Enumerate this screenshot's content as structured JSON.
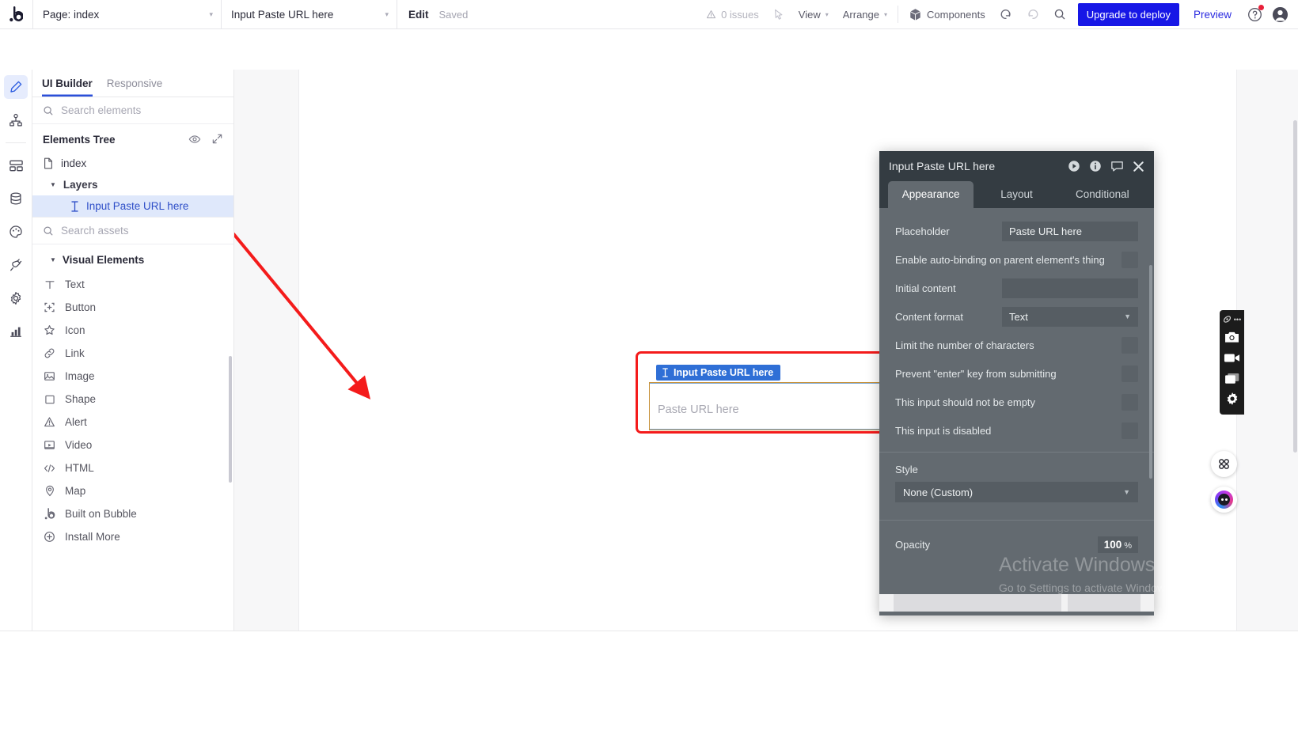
{
  "topbar": {
    "logo": "b",
    "page_select": {
      "label": "Page: index",
      "caret": "▾"
    },
    "element_select": {
      "label": "Input Paste URL here",
      "caret": "▾"
    },
    "edit_label": "Edit",
    "saved_label": "Saved",
    "issues": "0 issues",
    "view": "View",
    "arrange": "Arrange",
    "components": "Components",
    "upgrade": "Upgrade to deploy",
    "preview": "Preview",
    "accent_blue": "#1717e6",
    "notification_dot": "#e8203a"
  },
  "rail": {
    "items": [
      {
        "name": "design-pencil",
        "icon": "pencil-icon",
        "active": true
      },
      {
        "name": "workflow",
        "icon": "workflow-icon",
        "active": false
      },
      {
        "name": "layout",
        "icon": "layout-icon",
        "active": false
      },
      {
        "name": "data",
        "icon": "database-icon",
        "active": false
      },
      {
        "name": "styles",
        "icon": "palette-icon",
        "active": false
      },
      {
        "name": "plugins",
        "icon": "plug-icon",
        "active": false
      },
      {
        "name": "settings",
        "icon": "gear-icon",
        "active": false
      },
      {
        "name": "logs",
        "icon": "bar-chart-icon",
        "active": false
      }
    ]
  },
  "left_panel": {
    "tabs": [
      {
        "label": "UI Builder",
        "active": true
      },
      {
        "label": "Responsive",
        "active": false
      }
    ],
    "search_elements_placeholder": "Search elements",
    "elements_tree_title": "Elements Tree",
    "tree": [
      {
        "label": "index",
        "icon": "page-icon",
        "level": 0,
        "selected": false
      },
      {
        "label": "Layers",
        "icon": "triangle-down-icon",
        "level": 1,
        "selected": false
      },
      {
        "label": "Input Paste URL here",
        "icon": "input-cursor-icon",
        "level": 2,
        "selected": true
      }
    ],
    "search_assets_placeholder": "Search assets",
    "visual_elements_title": "Visual Elements",
    "visual_elements": [
      {
        "label": "Text",
        "icon": "text-icon"
      },
      {
        "label": "Button",
        "icon": "button-icon"
      },
      {
        "label": "Icon",
        "icon": "star-icon"
      },
      {
        "label": "Link",
        "icon": "link-icon"
      },
      {
        "label": "Image",
        "icon": "image-icon"
      },
      {
        "label": "Shape",
        "icon": "square-icon"
      },
      {
        "label": "Alert",
        "icon": "alert-triangle-icon"
      },
      {
        "label": "Video",
        "icon": "video-icon"
      },
      {
        "label": "HTML",
        "icon": "code-icon"
      },
      {
        "label": "Map",
        "icon": "map-pin-icon"
      },
      {
        "label": "Built on Bubble",
        "icon": "bubble-logo-icon"
      },
      {
        "label": "Install More",
        "icon": "plus-circle-icon"
      }
    ]
  },
  "canvas": {
    "element_badge": "Input Paste URL here",
    "input_placeholder": "Paste URL here",
    "highlight_color": "#f41b1b",
    "badge_color": "#2f6fd6"
  },
  "properties": {
    "title": "Input Paste URL here",
    "header_icons": [
      "play-icon",
      "info-icon",
      "comment-icon",
      "close-icon"
    ],
    "tabs": [
      {
        "label": "Appearance",
        "active": true
      },
      {
        "label": "Layout",
        "active": false
      },
      {
        "label": "Conditional",
        "active": false
      }
    ],
    "fields": [
      {
        "label": "Placeholder",
        "type": "text",
        "value": "Paste URL here"
      },
      {
        "label": "Enable auto-binding on parent element's thing",
        "type": "checkbox",
        "checked": false
      },
      {
        "label": "Initial content",
        "type": "text",
        "value": ""
      },
      {
        "label": "Content format",
        "type": "select",
        "value": "Text"
      },
      {
        "label": "Limit the number of characters",
        "type": "checkbox",
        "checked": false
      },
      {
        "label": "Prevent \"enter\" key from submitting",
        "type": "checkbox",
        "checked": false
      },
      {
        "label": "This input should not be empty",
        "type": "checkbox",
        "checked": false
      },
      {
        "label": "This input is disabled",
        "type": "checkbox",
        "checked": false
      }
    ],
    "style_label": "Style",
    "style_value": "None (Custom)",
    "opacity_label": "Opacity",
    "opacity_value": "100",
    "opacity_unit": "%"
  },
  "watermark": {
    "line1": "Activate Windows",
    "line2": "Go to Settings to activate Windows."
  },
  "float_toolbar": {
    "items": [
      {
        "name": "recorder-logo",
        "icon": "recorder-logo-icon"
      },
      {
        "name": "screenshot",
        "icon": "camera-icon"
      },
      {
        "name": "record-video",
        "icon": "video-camera-icon"
      },
      {
        "name": "capture-window",
        "icon": "window-icon"
      },
      {
        "name": "recorder-settings",
        "icon": "gear-icon"
      }
    ],
    "apps_button": "apps-grid-icon",
    "assistant_button": "ai-assistant-icon"
  }
}
